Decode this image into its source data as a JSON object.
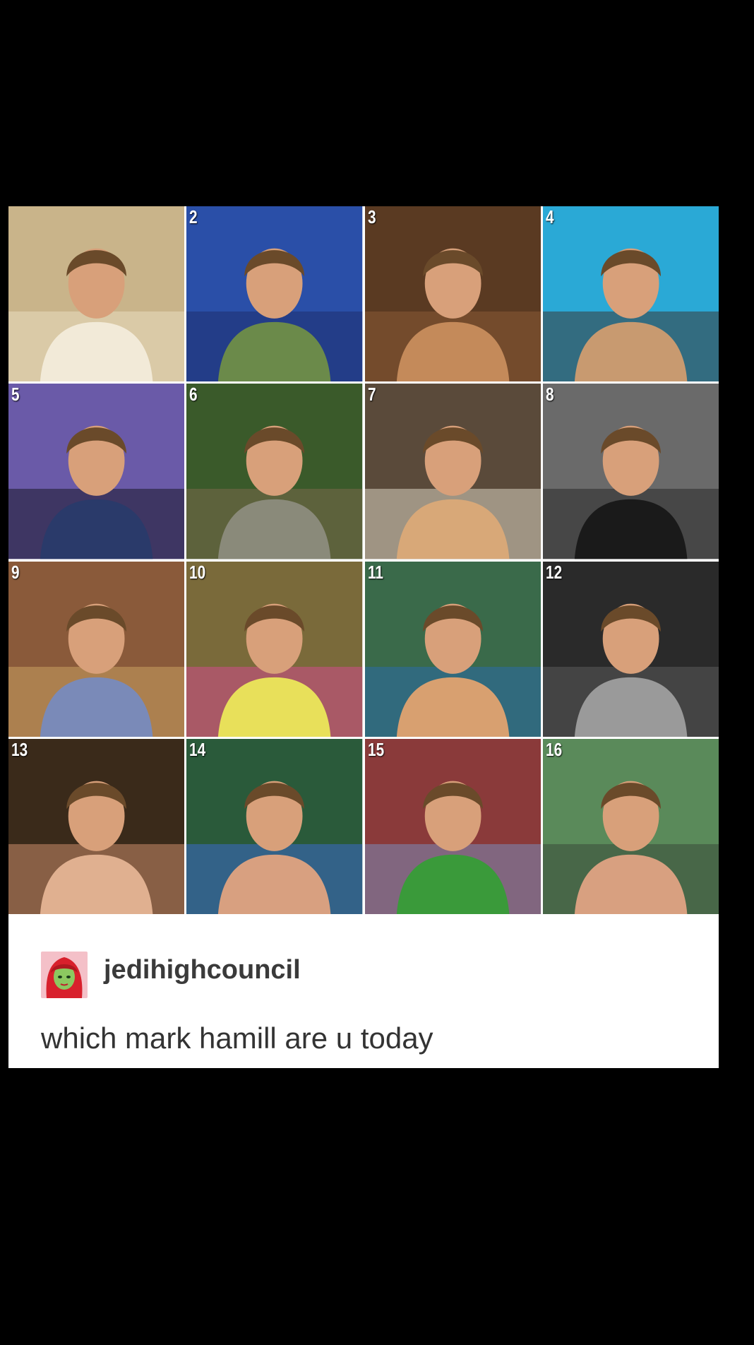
{
  "post": {
    "username": "jedihighcouncil",
    "text": "which mark hamill are u today",
    "avatar_icon": "avatar-icon"
  },
  "tiles": [
    {
      "number": "",
      "bg": "#c9b48a",
      "accent": "#e8dcc0",
      "subject": "#f2ead8"
    },
    {
      "number": "2",
      "bg": "#2a4fa8",
      "accent": "#1d2f6e",
      "subject": "#6b8a4a"
    },
    {
      "number": "3",
      "bg": "#5a3a22",
      "accent": "#8a5a34",
      "subject": "#c48a5a"
    },
    {
      "number": "4",
      "bg": "#2aa9d6",
      "accent": "#3a3a3a",
      "subject": "#c89a70"
    },
    {
      "number": "5",
      "bg": "#6a5aa8",
      "accent": "#1a1a2a",
      "subject": "#2a3a6a"
    },
    {
      "number": "6",
      "bg": "#3a5a2a",
      "accent": "#7a6a4a",
      "subject": "#8a8a7a"
    },
    {
      "number": "7",
      "bg": "#5a4a3a",
      "accent": "#d8d2c0",
      "subject": "#d8a878"
    },
    {
      "number": "8",
      "bg": "#6a6a6a",
      "accent": "#2a2a2a",
      "subject": "#1a1a1a"
    },
    {
      "number": "9",
      "bg": "#8a5a3a",
      "accent": "#c8a060",
      "subject": "#7a8ab8"
    },
    {
      "number": "10",
      "bg": "#7a6a3a",
      "accent": "#d04a8a",
      "subject": "#e8e05a"
    },
    {
      "number": "11",
      "bg": "#3a6a4a",
      "accent": "#2a6aa8",
      "subject": "#d8a070"
    },
    {
      "number": "12",
      "bg": "#2a2a2a",
      "accent": "#5a5a5a",
      "subject": "#9a9a9a"
    },
    {
      "number": "13",
      "bg": "#3a2a1a",
      "accent": "#c88a6a",
      "subject": "#e0b090"
    },
    {
      "number": "14",
      "bg": "#2a5a3a",
      "accent": "#3a6ac8",
      "subject": "#d8a080"
    },
    {
      "number": "15",
      "bg": "#8a3a3a",
      "accent": "#7a8ab8",
      "subject": "#3a9a3a"
    },
    {
      "number": "16",
      "bg": "#5a8a5a",
      "accent": "#3a4a3a",
      "subject": "#d8a080"
    }
  ]
}
